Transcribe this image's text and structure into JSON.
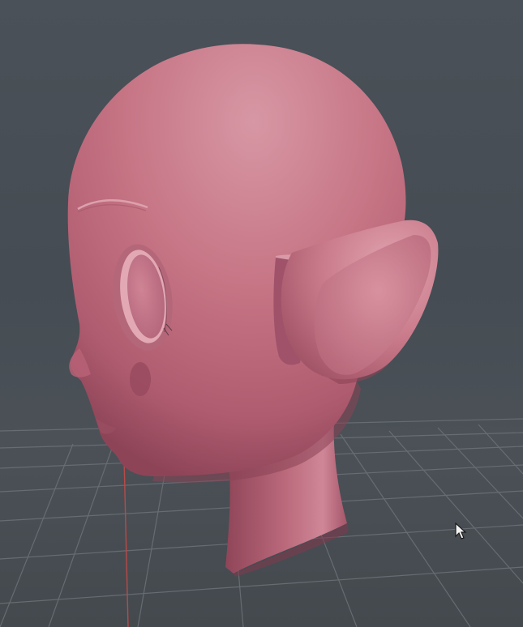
{
  "viewport": {
    "background_color": "#434b53",
    "grid_color": "#6c7278",
    "axis_color": "#b84a48",
    "model_base_color": "#c27080",
    "model_highlight_color": "#d996a3",
    "model_shadow_color": "#8e4457"
  },
  "cursor": {
    "icon": "arrow-pointer-icon"
  }
}
